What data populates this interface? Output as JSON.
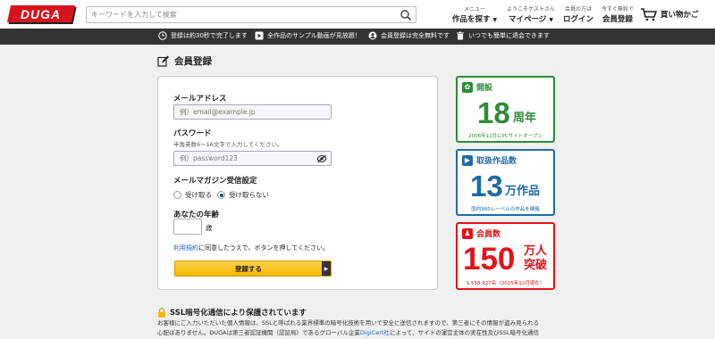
{
  "header": {
    "logo": "DUGA",
    "search_placeholder": "キーワードを入力して検索",
    "nav": [
      {
        "small": "メニュー",
        "big": "作品を探す"
      },
      {
        "small": "ようこそゲストさん",
        "big": "マイページ"
      },
      {
        "small": "会員の方は",
        "big": "ログイン"
      },
      {
        "small": "今すぐ無料で",
        "big": "会員登録"
      }
    ],
    "cart_label": "買い物かご"
  },
  "infobar": {
    "items": [
      {
        "icon": "clock-icon",
        "text": "登録は約30秒で完了します"
      },
      {
        "icon": "video-icon",
        "text": "全作品のサンプル動画が見放題！"
      },
      {
        "icon": "user-icon",
        "text": "会員登録は完全無料です"
      },
      {
        "icon": "trash-icon",
        "text": "いつでも簡単に退会できます"
      }
    ]
  },
  "page_title": "会員登録",
  "form": {
    "email_label": "メールアドレス",
    "email_placeholder": "例）email@example.jp",
    "password_label": "パスワード",
    "password_hint": "半角英数6～16文字で入力してください。",
    "password_placeholder": "例）password123",
    "newsletter_label": "メールマガジン受信設定",
    "newsletter_options": [
      "受け取る",
      "受け取らない"
    ],
    "newsletter_selected": "受け取らない",
    "age_label": "あなたの年齢",
    "age_unit": "歳",
    "terms_link": "利用規約",
    "terms_text": "に同意したうえで、ボタンを押してください。",
    "submit_label": "登録する"
  },
  "stats": [
    {
      "icon": "sprout-icon",
      "title": "開設",
      "number": "18",
      "unit": "周年",
      "note": "2006年12月にPCサイトオープン",
      "color": "#2e8b3a"
    },
    {
      "icon": "play-icon",
      "title": "取扱作品数",
      "number": "13",
      "unit": "万作品",
      "note": "国内960レーベルの作品を網羅",
      "color": "#1e6aa8"
    },
    {
      "icon": "people-icon",
      "title": "会員数",
      "number": "150",
      "unit_line1": "万人",
      "unit_line2": "突破",
      "note": "1,558,927名（2025年12月現在）",
      "color": "#e0131b"
    }
  ],
  "ssl": {
    "title": "SSL暗号化通信により保護されています",
    "line1": "お客様にご入力いただいた個人情報は、SSLと呼ばれる業界標準の暗号化技術を用いて安全に送信されますので、第三者にその情報が盗み見られる",
    "line2": "心配はありません。DUGAは第三者認証機関（認証局）であるグローバル企業",
    "line2_link": "DigiCert社",
    "line2_tail": "によって、サイトの運営主体の実在性及びSSL暗号化通信"
  }
}
